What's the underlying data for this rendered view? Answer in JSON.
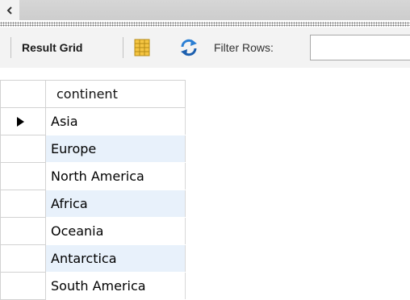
{
  "scrollbar": {
    "left_button_icon": "chevron-left-icon"
  },
  "toolbar": {
    "result_grid_label": "Result Grid",
    "grid_icon": "grid-columns-icon",
    "refresh_icon": "refresh-icon",
    "filter_label": "Filter Rows:",
    "filter_value": ""
  },
  "grid": {
    "columns": [
      "continent"
    ],
    "current_row_indicator": "row-pointer-icon",
    "rows": [
      "Asia",
      "Europe",
      "North America",
      "Africa",
      "Oceania",
      "Antarctica",
      "South America"
    ]
  },
  "colors": {
    "alt_row": "#e8f1fb",
    "toolbar_bg": "#f3f3f3",
    "grid_icon_fill": "#f5c542",
    "refresh_blue": "#2b7fd4"
  }
}
